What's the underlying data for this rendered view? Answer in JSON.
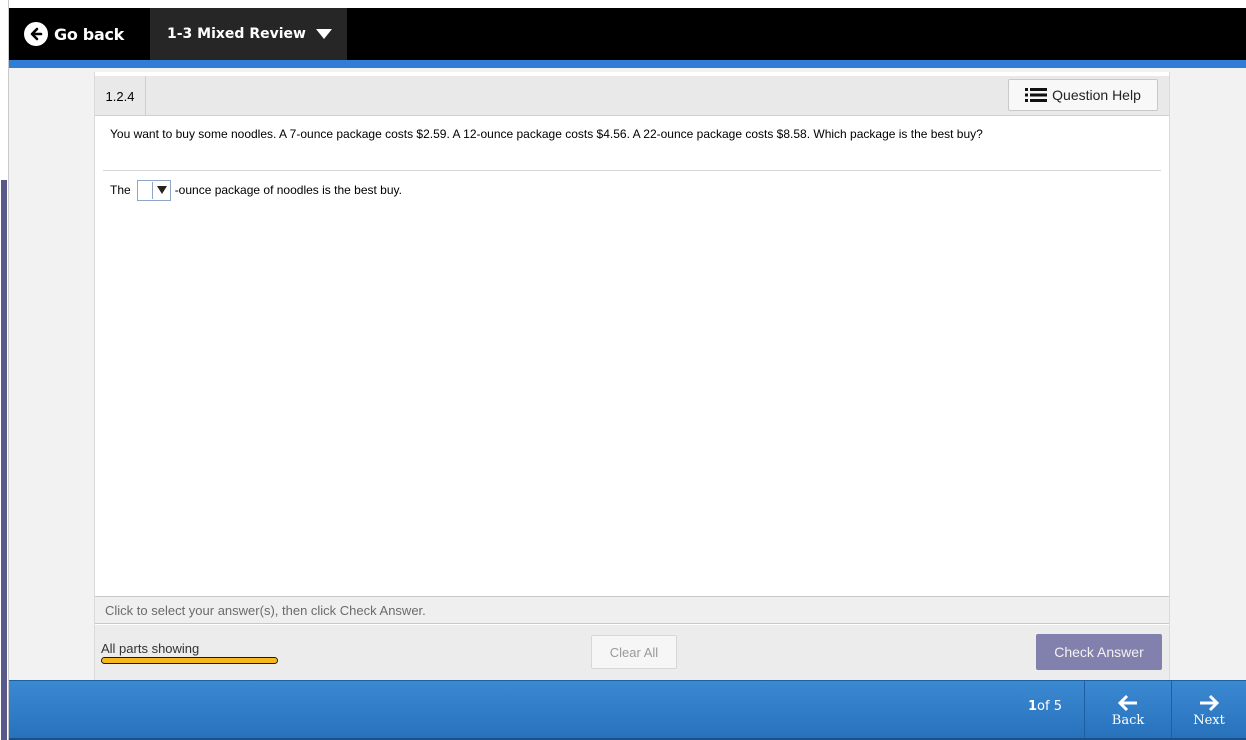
{
  "header": {
    "go_back_label": "Go back",
    "assignment_title": "1-3 Mixed Review"
  },
  "question": {
    "number": "1.2.4",
    "help_label": "Question Help",
    "prompt": "You want to buy some noodles. A 7-ounce package costs $2.59. A 12-ounce package costs $4.56. A 22-ounce package costs $8.58. Which package is the best buy?",
    "answer_prefix": "The",
    "answer_selected": "",
    "answer_suffix": "-ounce package of noodles is the best buy."
  },
  "footer": {
    "instructions": "Click to select your answer(s), then click Check Answer.",
    "parts_label": "All parts showing",
    "parts_progress": 1.0,
    "clear_all_label": "Clear All",
    "check_answer_label": "Check Answer"
  },
  "navigation": {
    "current": "1",
    "of_total": "of 5",
    "back_label": "Back",
    "next_label": "Next"
  },
  "colors": {
    "topbar": "#000000",
    "accent_blue": "#2f7dd6",
    "check_answer": "#8280ad",
    "progress": "#f5b81c"
  },
  "icons": {
    "go_back": "circle-arrow-left-icon",
    "title_menu": "caret-down-icon",
    "help": "list-icon",
    "dropdown": "caret-down-icon",
    "back": "arrow-left-icon",
    "next": "arrow-right-icon"
  }
}
